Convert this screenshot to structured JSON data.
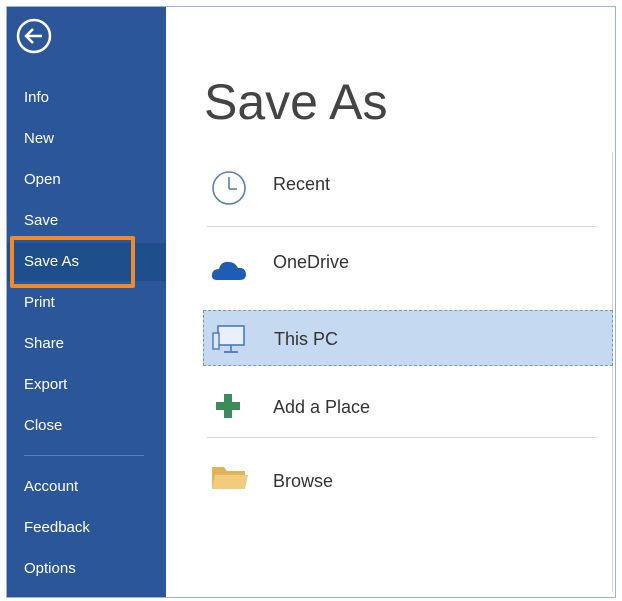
{
  "sidebar": {
    "items": [
      {
        "key": "info",
        "label": "Info"
      },
      {
        "key": "new",
        "label": "New"
      },
      {
        "key": "open",
        "label": "Open"
      },
      {
        "key": "save",
        "label": "Save"
      },
      {
        "key": "save-as",
        "label": "Save As",
        "selected": true
      },
      {
        "key": "print",
        "label": "Print"
      },
      {
        "key": "share",
        "label": "Share"
      },
      {
        "key": "export",
        "label": "Export"
      },
      {
        "key": "close",
        "label": "Close"
      },
      {
        "key": "account",
        "label": "Account"
      },
      {
        "key": "feedback",
        "label": "Feedback"
      },
      {
        "key": "options",
        "label": "Options"
      }
    ]
  },
  "main": {
    "title": "Save As",
    "places": [
      {
        "key": "recent",
        "label": "Recent",
        "icon": "clock-icon"
      },
      {
        "key": "onedrive",
        "label": "OneDrive",
        "icon": "cloud-icon"
      },
      {
        "key": "this-pc",
        "label": "This PC",
        "icon": "computer-icon",
        "selected": true
      },
      {
        "key": "add-place",
        "label": "Add a Place",
        "icon": "plus-icon"
      },
      {
        "key": "browse",
        "label": "Browse",
        "icon": "folder-icon"
      }
    ]
  },
  "colors": {
    "sidebar_bg": "#2b579a",
    "selected_nav_bg": "#1e4e8c",
    "highlight_border": "#f08a2a",
    "selected_place_bg": "#c5d9f1"
  }
}
